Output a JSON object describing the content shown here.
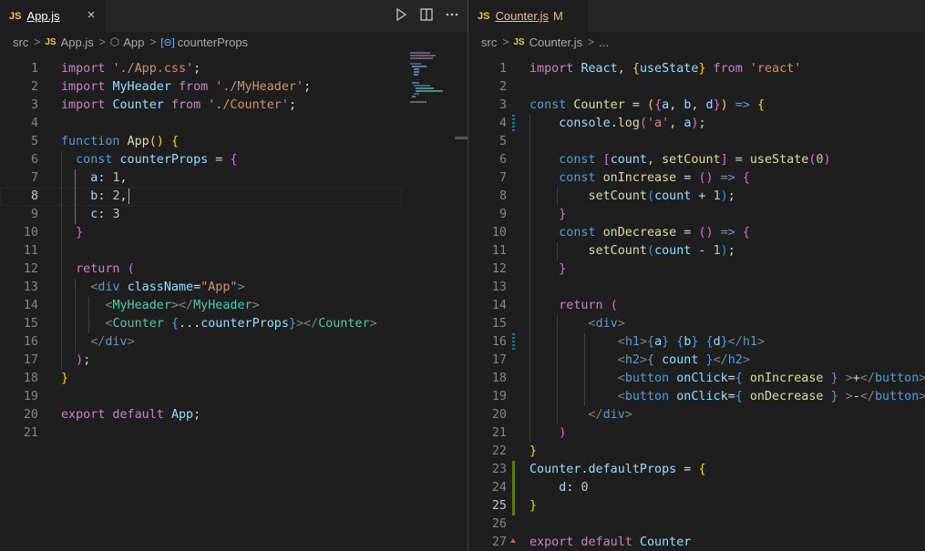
{
  "left": {
    "tab": {
      "icon": "JS",
      "label": "App.js",
      "close": "×"
    },
    "actions": [
      "run-icon",
      "split-editor-icon",
      "more-actions-icon"
    ],
    "breadcrumb": [
      "src",
      "App.js",
      "App",
      "counterProps"
    ],
    "current_line": 8,
    "lines": [
      [
        [
          "k",
          "import "
        ],
        [
          "s",
          "'./App.css'"
        ],
        [
          "d",
          ";"
        ]
      ],
      [
        [
          "k",
          "import "
        ],
        [
          "v",
          "MyHeader"
        ],
        [
          "k",
          " from "
        ],
        [
          "s",
          "'./MyHeader'"
        ],
        [
          "d",
          ";"
        ]
      ],
      [
        [
          "k",
          "import "
        ],
        [
          "v",
          "Counter"
        ],
        [
          "k",
          " from "
        ],
        [
          "s",
          "'./Counter'"
        ],
        [
          "d",
          ";"
        ]
      ],
      [],
      [
        [
          "b",
          "function "
        ],
        [
          "f",
          "App"
        ],
        [
          "p",
          "()"
        ],
        [
          "d",
          " "
        ],
        [
          "p",
          "{"
        ]
      ],
      [
        [
          "d",
          "  "
        ],
        [
          "b",
          "const "
        ],
        [
          "v",
          "counterProps"
        ],
        [
          "d",
          " = "
        ],
        [
          "p2",
          "{"
        ]
      ],
      [
        [
          "d",
          "    "
        ],
        [
          "v",
          "a"
        ],
        [
          "d",
          ": "
        ],
        [
          "n",
          "1"
        ],
        [
          "d",
          ","
        ]
      ],
      [
        [
          "d",
          "    "
        ],
        [
          "v",
          "b"
        ],
        [
          "d",
          ": "
        ],
        [
          "n",
          "2"
        ],
        [
          "d",
          ","
        ]
      ],
      [
        [
          "d",
          "    "
        ],
        [
          "v",
          "c"
        ],
        [
          "d",
          ": "
        ],
        [
          "n",
          "3"
        ]
      ],
      [
        [
          "d",
          "  "
        ],
        [
          "p2",
          "}"
        ]
      ],
      [],
      [
        [
          "d",
          "  "
        ],
        [
          "k",
          "return "
        ],
        [
          "p2",
          "("
        ]
      ],
      [
        [
          "d",
          "    "
        ],
        [
          "t",
          "<"
        ],
        [
          "b",
          "div"
        ],
        [
          "d",
          " "
        ],
        [
          "v",
          "className"
        ],
        [
          "d",
          "="
        ],
        [
          "s",
          "\"App\""
        ],
        [
          "t",
          ">"
        ]
      ],
      [
        [
          "d",
          "      "
        ],
        [
          "t",
          "<"
        ],
        [
          "c",
          "MyHeader"
        ],
        [
          "t",
          "></"
        ],
        [
          "c",
          "MyHeader"
        ],
        [
          "t",
          ">"
        ]
      ],
      [
        [
          "d",
          "      "
        ],
        [
          "t",
          "<"
        ],
        [
          "c",
          "Counter"
        ],
        [
          "d",
          " "
        ],
        [
          "b",
          "{"
        ],
        [
          "d",
          "..."
        ],
        [
          "v",
          "counterProps"
        ],
        [
          "b",
          "}"
        ],
        [
          "t",
          "></"
        ],
        [
          "c",
          "Counter"
        ],
        [
          "t",
          ">"
        ]
      ],
      [
        [
          "d",
          "    "
        ],
        [
          "t",
          "</"
        ],
        [
          "b",
          "div"
        ],
        [
          "t",
          ">"
        ]
      ],
      [
        [
          "d",
          "  "
        ],
        [
          "p2",
          ")"
        ],
        [
          "d",
          ";"
        ]
      ],
      [
        [
          "p",
          "}"
        ]
      ],
      [],
      [
        [
          "k",
          "export default "
        ],
        [
          "v",
          "App"
        ],
        [
          "d",
          ";"
        ]
      ],
      []
    ]
  },
  "right": {
    "tab": {
      "icon": "JS",
      "label": "Counter.js",
      "modified": "M"
    },
    "breadcrumb": [
      "src",
      "Counter.js",
      "..."
    ],
    "current_line": 25,
    "lines": [
      [
        [
          "k",
          "import "
        ],
        [
          "v",
          "React"
        ],
        [
          "d",
          ", "
        ],
        [
          "p",
          "{"
        ],
        [
          "v",
          "useState"
        ],
        [
          "p",
          "}"
        ],
        [
          "k",
          " from "
        ],
        [
          "s",
          "'react'"
        ]
      ],
      [],
      [
        [
          "b",
          "const "
        ],
        [
          "f",
          "Counter"
        ],
        [
          "d",
          " = "
        ],
        [
          "p",
          "("
        ],
        [
          "p2",
          "{"
        ],
        [
          "v",
          "a"
        ],
        [
          "d",
          ", "
        ],
        [
          "v",
          "b"
        ],
        [
          "d",
          ", "
        ],
        [
          "v",
          "d"
        ],
        [
          "p2",
          "}"
        ],
        [
          "p",
          ")"
        ],
        [
          "d",
          " "
        ],
        [
          "b",
          "=>"
        ],
        [
          "d",
          " "
        ],
        [
          "p",
          "{"
        ]
      ],
      [
        [
          "d",
          "    "
        ],
        [
          "v",
          "console"
        ],
        [
          "d",
          "."
        ],
        [
          "f",
          "log"
        ],
        [
          "p2",
          "("
        ],
        [
          "s",
          "'a'"
        ],
        [
          "d",
          ", "
        ],
        [
          "v",
          "a"
        ],
        [
          "p2",
          ")"
        ],
        [
          "d",
          ";"
        ]
      ],
      [],
      [
        [
          "d",
          "    "
        ],
        [
          "b",
          "const "
        ],
        [
          "p2",
          "["
        ],
        [
          "v",
          "count"
        ],
        [
          "d",
          ", "
        ],
        [
          "f",
          "setCount"
        ],
        [
          "p2",
          "]"
        ],
        [
          "d",
          " = "
        ],
        [
          "f",
          "useState"
        ],
        [
          "p2",
          "("
        ],
        [
          "n",
          "0"
        ],
        [
          "p2",
          ")"
        ]
      ],
      [
        [
          "d",
          "    "
        ],
        [
          "b",
          "const "
        ],
        [
          "f",
          "onIncrease"
        ],
        [
          "d",
          " = "
        ],
        [
          "p2",
          "()"
        ],
        [
          "d",
          " "
        ],
        [
          "b",
          "=>"
        ],
        [
          "d",
          " "
        ],
        [
          "p2",
          "{"
        ]
      ],
      [
        [
          "d",
          "        "
        ],
        [
          "f",
          "setCount"
        ],
        [
          "p3",
          "("
        ],
        [
          "v",
          "count"
        ],
        [
          "d",
          " + "
        ],
        [
          "n",
          "1"
        ],
        [
          "p3",
          ")"
        ],
        [
          "d",
          ";"
        ]
      ],
      [
        [
          "d",
          "    "
        ],
        [
          "p2",
          "}"
        ]
      ],
      [
        [
          "d",
          "    "
        ],
        [
          "b",
          "const "
        ],
        [
          "f",
          "onDecrease"
        ],
        [
          "d",
          " = "
        ],
        [
          "p2",
          "()"
        ],
        [
          "d",
          " "
        ],
        [
          "b",
          "=>"
        ],
        [
          "d",
          " "
        ],
        [
          "p2",
          "{"
        ]
      ],
      [
        [
          "d",
          "        "
        ],
        [
          "f",
          "setCount"
        ],
        [
          "p3",
          "("
        ],
        [
          "v",
          "count"
        ],
        [
          "d",
          " - "
        ],
        [
          "n",
          "1"
        ],
        [
          "p3",
          ")"
        ],
        [
          "d",
          ";"
        ]
      ],
      [
        [
          "d",
          "    "
        ],
        [
          "p2",
          "}"
        ]
      ],
      [],
      [
        [
          "d",
          "    "
        ],
        [
          "k",
          "return "
        ],
        [
          "p2",
          "("
        ]
      ],
      [
        [
          "d",
          "        "
        ],
        [
          "t",
          "<"
        ],
        [
          "b",
          "div"
        ],
        [
          "t",
          ">"
        ]
      ],
      [
        [
          "d",
          "            "
        ],
        [
          "t",
          "<"
        ],
        [
          "b",
          "h1"
        ],
        [
          "t",
          ">"
        ],
        [
          "b",
          "{"
        ],
        [
          "v",
          "a"
        ],
        [
          "b",
          "}"
        ],
        [
          "d",
          " "
        ],
        [
          "b",
          "{"
        ],
        [
          "v",
          "b"
        ],
        [
          "b",
          "}"
        ],
        [
          "d",
          " "
        ],
        [
          "b",
          "{"
        ],
        [
          "v",
          "d"
        ],
        [
          "b",
          "}"
        ],
        [
          "t",
          "</"
        ],
        [
          "b",
          "h1"
        ],
        [
          "t",
          ">"
        ]
      ],
      [
        [
          "d",
          "            "
        ],
        [
          "t",
          "<"
        ],
        [
          "b",
          "h2"
        ],
        [
          "t",
          ">"
        ],
        [
          "b",
          "{"
        ],
        [
          "d",
          " "
        ],
        [
          "v",
          "count"
        ],
        [
          "d",
          " "
        ],
        [
          "b",
          "}"
        ],
        [
          "t",
          "</"
        ],
        [
          "b",
          "h2"
        ],
        [
          "t",
          ">"
        ]
      ],
      [
        [
          "d",
          "            "
        ],
        [
          "t",
          "<"
        ],
        [
          "b",
          "button"
        ],
        [
          "d",
          " "
        ],
        [
          "v",
          "onClick"
        ],
        [
          "d",
          "="
        ],
        [
          "b",
          "{"
        ],
        [
          "d",
          " "
        ],
        [
          "f",
          "onIncrease"
        ],
        [
          "d",
          " "
        ],
        [
          "b",
          "}"
        ],
        [
          "d",
          " "
        ],
        [
          "t",
          ">"
        ],
        [
          "d",
          "+"
        ],
        [
          "t",
          "</"
        ],
        [
          "b",
          "button"
        ],
        [
          "t",
          ">"
        ]
      ],
      [
        [
          "d",
          "            "
        ],
        [
          "t",
          "<"
        ],
        [
          "b",
          "button"
        ],
        [
          "d",
          " "
        ],
        [
          "v",
          "onClick"
        ],
        [
          "d",
          "="
        ],
        [
          "b",
          "{"
        ],
        [
          "d",
          " "
        ],
        [
          "f",
          "onDecrease"
        ],
        [
          "d",
          " "
        ],
        [
          "b",
          "}"
        ],
        [
          "d",
          " "
        ],
        [
          "t",
          ">"
        ],
        [
          "d",
          "-"
        ],
        [
          "t",
          "</"
        ],
        [
          "b",
          "button"
        ],
        [
          "t",
          ">"
        ]
      ],
      [
        [
          "d",
          "        "
        ],
        [
          "t",
          "</"
        ],
        [
          "b",
          "div"
        ],
        [
          "t",
          ">"
        ]
      ],
      [
        [
          "d",
          "    "
        ],
        [
          "p2",
          ")"
        ]
      ],
      [
        [
          "p",
          "}"
        ]
      ],
      [
        [
          "v",
          "Counter"
        ],
        [
          "d",
          "."
        ],
        [
          "v",
          "defaultProps"
        ],
        [
          "d",
          " = "
        ],
        [
          "p",
          "{"
        ]
      ],
      [
        [
          "d",
          "    "
        ],
        [
          "v",
          "d"
        ],
        [
          "d",
          ": "
        ],
        [
          "n",
          "0"
        ]
      ],
      [
        [
          "p",
          "}"
        ]
      ],
      [],
      [
        [
          "k",
          "export default "
        ],
        [
          "v",
          "Counter"
        ]
      ]
    ]
  }
}
